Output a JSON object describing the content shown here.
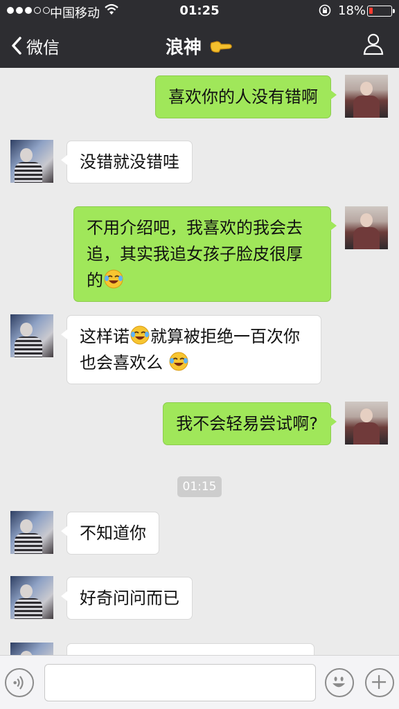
{
  "status_bar": {
    "carrier": "中国移动",
    "time": "01:25",
    "battery_percent": "18%",
    "battery_level": 0.18,
    "signal_dots": 5,
    "signal_filled": 3
  },
  "nav": {
    "back_label": "微信",
    "title": "浪神",
    "title_icon": "pointing-hand-icon",
    "profile_icon": "person-icon"
  },
  "messages": [
    {
      "side": "me",
      "text": "喜欢你的人没有错啊"
    },
    {
      "side": "them",
      "text": "没错就没错哇"
    },
    {
      "side": "me",
      "line1": "不用介绍吧，我喜欢的我会去",
      "line2": "追，其实我追女孩子脸皮很厚",
      "line3": "的",
      "emoji": "tears-of-joy-icon"
    },
    {
      "side": "them",
      "line1a": "这样诺",
      "line1b": "就算被拒绝一百次你",
      "line2": "也会喜欢么",
      "emoji": "tears-of-joy-icon"
    },
    {
      "side": "me",
      "text": "我不会轻易尝试啊?"
    },
    {
      "side": "them",
      "text": "不知道你"
    },
    {
      "side": "them",
      "text": "好奇问问而已"
    },
    {
      "side": "them",
      "text": ""
    }
  ],
  "timestamp": "01:15",
  "input_bar": {
    "voice_icon": "voice-icon",
    "input_value": "",
    "emoji_icon": "smiley-icon",
    "more_icon": "plus-icon"
  },
  "colors": {
    "nav_bg": "#2d2d31",
    "my_bubble": "#a0e75a",
    "their_bubble": "#ffffff",
    "chat_bg": "#ebebeb"
  }
}
